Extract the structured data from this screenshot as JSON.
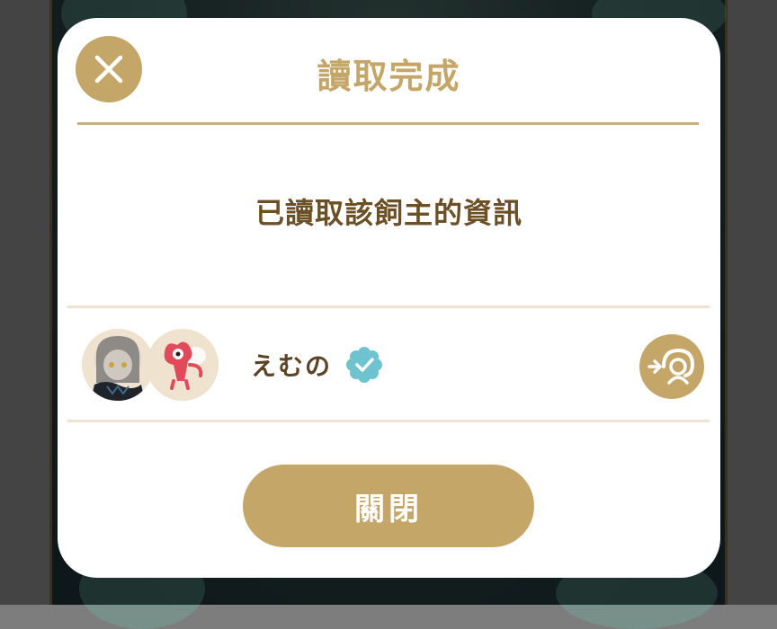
{
  "dialog": {
    "title": "讀取完成",
    "message": "已讀取該飼主的資訊",
    "close_button_label": "關閉"
  },
  "owner": {
    "name": "えむの",
    "verified_icon": "verified-badge-icon",
    "action_icon": "visit-owner-icon"
  },
  "colors": {
    "accent": "#c4a668",
    "title_text": "#c4a668",
    "message_text": "#6b4f25",
    "name_text": "#5a4424",
    "divider": "#efe2cf",
    "verified_badge": "#6ec3cf",
    "background": "#ffffff"
  }
}
